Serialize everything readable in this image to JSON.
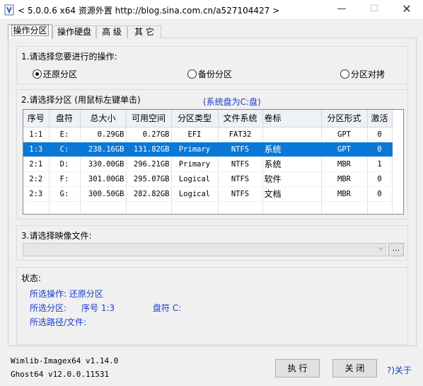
{
  "window": {
    "title": "< 5.0.0.6 x64 资源外置 http://blog.sina.com.cn/a527104427 >",
    "minimize": "—",
    "maximize": "☐",
    "close": "✕"
  },
  "tabs": [
    {
      "label": "操作分区",
      "active": true
    },
    {
      "label": "操作硬盘",
      "active": false
    },
    {
      "label": "高 级",
      "active": false
    },
    {
      "label": "其 它",
      "active": false
    }
  ],
  "operation": {
    "title": "1.请选择您要进行的操作:",
    "options": [
      {
        "label": "还原分区",
        "checked": true
      },
      {
        "label": "备份分区",
        "checked": false
      },
      {
        "label": "分区对拷",
        "checked": false
      }
    ]
  },
  "partition": {
    "title": "2.请选择分区 (用鼠标左键单击)",
    "system_disk": "(系统盘为C:盘)",
    "columns": [
      "序号",
      "盘符",
      "总大小",
      "可用空间",
      "分区类型",
      "文件系统",
      "卷标",
      "分区形式",
      "激活"
    ],
    "rows": [
      {
        "id": "1:1",
        "drive": "E:",
        "total": "0.29GB",
        "free": "0.27GB",
        "type": "EFI",
        "fs": "FAT32",
        "label": "",
        "style": "GPT",
        "active": "0",
        "selected": false
      },
      {
        "id": "1:3",
        "drive": "C:",
        "total": "238.16GB",
        "free": "131.82GB",
        "type": "Primary",
        "fs": "NTFS",
        "label": "系统",
        "style": "GPT",
        "active": "0",
        "selected": true
      },
      {
        "id": "2:1",
        "drive": "D:",
        "total": "330.00GB",
        "free": "296.21GB",
        "type": "Primary",
        "fs": "NTFS",
        "label": "系统",
        "style": "MBR",
        "active": "1",
        "selected": false
      },
      {
        "id": "2:2",
        "drive": "F:",
        "total": "301.00GB",
        "free": "295.07GB",
        "type": "Logical",
        "fs": "NTFS",
        "label": "软件",
        "style": "MBR",
        "active": "0",
        "selected": false
      },
      {
        "id": "2:3",
        "drive": "G:",
        "total": "300.50GB",
        "free": "282.82GB",
        "type": "Logical",
        "fs": "NTFS",
        "label": "文档",
        "style": "MBR",
        "active": "0",
        "selected": false
      }
    ]
  },
  "image_file": {
    "title": "3.请选择映像文件:",
    "value": "",
    "browse_label": "..."
  },
  "status": {
    "title": "状态:",
    "operation": "所选操作: 还原分区",
    "partition_label": "所选分区:",
    "partition_number": "序号 1:3",
    "drive_letter": "盘符 C:",
    "path": "所选路径/文件:"
  },
  "footer": {
    "wimlib_version": "Wimlib-Imagex64 v1.14.0",
    "ghost_version": "Ghost64 v12.0.0.11531",
    "execute_label": "执 行",
    "close_label": "关 闭",
    "about_label": "?)关于"
  },
  "colors": {
    "selection": "#0a78d7",
    "link_blue": "#1a3cc8"
  }
}
